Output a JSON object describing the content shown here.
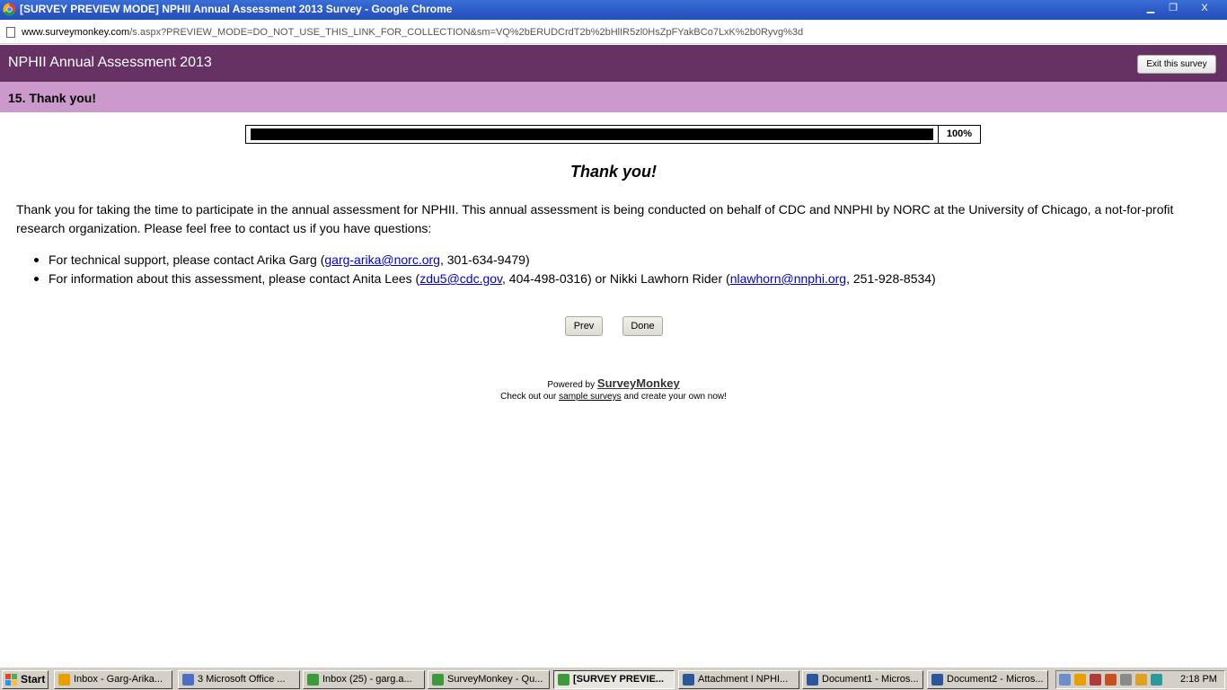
{
  "window": {
    "title": "[SURVEY PREVIEW MODE] NPHII Annual Assessment 2013 Survey - Google Chrome",
    "minimize_glyph": "▁",
    "maximize_glyph": "❐",
    "close_glyph": "X"
  },
  "address_bar": {
    "host": "www.surveymonkey.com",
    "path": "/s.aspx?PREVIEW_MODE=DO_NOT_USE_THIS_LINK_FOR_COLLECTION&sm=VQ%2bERUDCrdT2b%2bHlIR5zl0HsZpFYakBCo7LxK%2b0Ryvg%3d"
  },
  "survey": {
    "title": "NPHII Annual Assessment 2013",
    "exit_label": "Exit this survey",
    "page_heading": "15. Thank you!",
    "progress_percent": 100,
    "progress_label": "100%",
    "thanks_heading": "Thank you!",
    "intro": "Thank you for taking the time to participate in the annual assessment for NPHII. This annual assessment is being conducted on behalf of CDC and NNPHI by NORC at the University of Chicago, a not-for-profit research organization. Please feel free to contact us if you have questions:",
    "contacts": [
      {
        "before": "For technical support, please contact Arika Garg (",
        "email": "garg-arika@norc.org",
        "after": ", 301-634-9479)"
      },
      {
        "before": "For information about this assessment, please contact Anita Lees (",
        "email": "zdu5@cdc.gov",
        "middle": ", 404-498-0316) or Nikki Lawhorn Rider (",
        "email2": "nlawhorn@nnphi.org",
        "after": ", 251-928-8534)"
      }
    ],
    "prev_label": "Prev",
    "done_label": "Done",
    "powered_by": "Powered by",
    "brand": "SurveyMonkey",
    "checkout_before": "Check out our",
    "checkout_link": "sample surveys",
    "checkout_after": "and create your own now!"
  },
  "taskbar": {
    "start_label": "Start",
    "tasks": [
      {
        "label": "Inbox - Garg-Arika...",
        "icon": "outlook-icon",
        "color": "#e8a000"
      },
      {
        "label": "3 Microsoft Office ...",
        "icon": "office-icon",
        "color": "#4a6fc4"
      },
      {
        "label": "Inbox (25) - garg.a...",
        "icon": "chrome-icon",
        "color": "#3b9a3b"
      },
      {
        "label": "SurveyMonkey - Qu...",
        "icon": "chrome-icon",
        "color": "#3b9a3b"
      },
      {
        "label": "[SURVEY PREVIE...",
        "icon": "chrome-icon",
        "color": "#3b9a3b",
        "active": true
      },
      {
        "label": "Attachment I  NPHI...",
        "icon": "word-icon",
        "color": "#2b579a"
      },
      {
        "label": "Document1 - Micros...",
        "icon": "word-icon",
        "color": "#2b579a"
      },
      {
        "label": "Document2 - Micros...",
        "icon": "word-icon",
        "color": "#2b579a"
      }
    ],
    "clock": "2:18 PM"
  }
}
